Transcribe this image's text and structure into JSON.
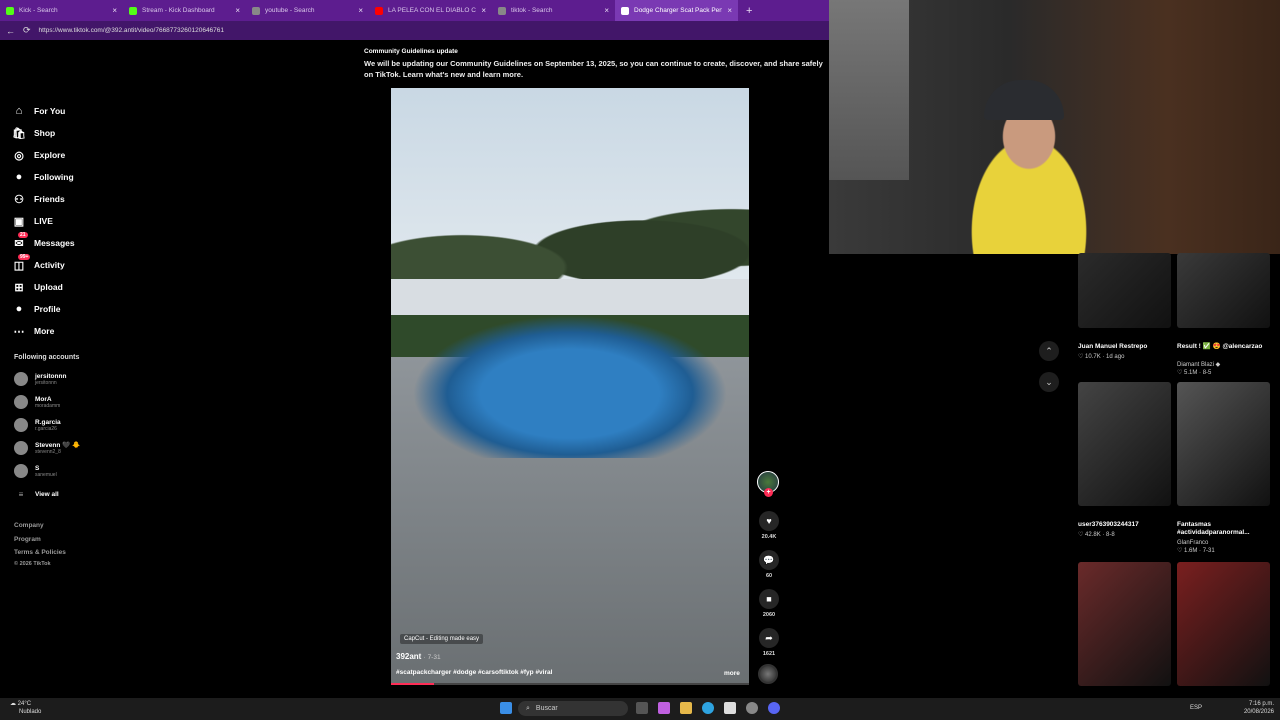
{
  "browser": {
    "tabs": [
      {
        "title": "Kick - Search",
        "color": "#53fc18"
      },
      {
        "title": "Stream - Kick Dashboard",
        "color": "#53fc18"
      },
      {
        "title": "youtube - Search",
        "color": "#888888"
      },
      {
        "title": "LA PELEA CON EL DIABLO CICTA...",
        "color": "#ff0000"
      },
      {
        "title": "tiktok - Search",
        "color": "#888888"
      },
      {
        "title": "Dodge Charger Scat Pack Perform...",
        "color": "#ffffff"
      }
    ],
    "url": "https://www.tiktok.com/@392.antit/video/7668773260120646761"
  },
  "sidebar": {
    "items": [
      {
        "label": "For You",
        "icon": "home-icon",
        "glyph": "⌂"
      },
      {
        "label": "Shop",
        "icon": "shop-icon",
        "glyph": "🛍"
      },
      {
        "label": "Explore",
        "icon": "compass-icon",
        "glyph": "◎"
      },
      {
        "label": "Following",
        "icon": "following-avatar-icon",
        "glyph": "●"
      },
      {
        "label": "Friends",
        "icon": "friends-icon",
        "glyph": "⚇"
      },
      {
        "label": "LIVE",
        "icon": "live-icon",
        "glyph": "▣"
      },
      {
        "label": "Messages",
        "icon": "messages-icon",
        "glyph": "✉",
        "badge": "21"
      },
      {
        "label": "Activity",
        "icon": "activity-icon",
        "glyph": "◫",
        "badge": "99+"
      },
      {
        "label": "Upload",
        "icon": "upload-icon",
        "glyph": "⊞"
      },
      {
        "label": "Profile",
        "icon": "profile-icon",
        "glyph": "●"
      },
      {
        "label": "More",
        "icon": "more-icon",
        "glyph": "⋯"
      }
    ],
    "following_title": "Following accounts",
    "accounts": [
      {
        "name": "jersitonnn",
        "handle": "jersitonnn"
      },
      {
        "name": "MorA",
        "handle": "moradamm"
      },
      {
        "name": "R.garcia",
        "handle": "r.garcia26"
      },
      {
        "name": "Stevenn 🖤 🐥",
        "handle": "stevenn2_8"
      },
      {
        "name": "S",
        "handle": "sanemuel"
      }
    ],
    "view_all": "View all",
    "footer": [
      "Company",
      "Program",
      "Terms & Policies",
      "© 2026 TikTok"
    ]
  },
  "notice": {
    "title": "Community Guidelines update",
    "body": "We will be updating our Community Guidelines on September 13, 2025, so you can continue to create, discover, and share safely on TikTok. Learn what's new and learn more."
  },
  "video": {
    "capcut": "CapCut - Editing made easy",
    "author": "392ant",
    "date": "· 7-31",
    "tags": "#scatpackcharger #dodge #carsoftiktok #fyp #viral",
    "more": "more",
    "progress": 0.12,
    "likes": "20.4K",
    "comments": "60",
    "saves": "2060",
    "shares": "1621"
  },
  "grid": [
    {
      "title": "Juan Manuel Restrepo",
      "stats": "♡ 10.7K · 1d ago",
      "bg": "#2b2b2b"
    },
    {
      "title": "Result ! ✅ 😍 @alencarzao",
      "stats": "Diamant Blazi ◆",
      "stats2": "♡ 5.1M · 8-5",
      "bg": "#3a3a3a"
    },
    {
      "title": "user3763903244317",
      "stats": "♡ 42.8K · 8-8",
      "bg": "#444444"
    },
    {
      "title": "Fantasmas #actividadparanormal...",
      "stats": "GlanFranco",
      "stats2": "♡ 1.6M · 7-31",
      "bg": "#555555"
    },
    {
      "title": "",
      "stats": "",
      "bg": "#6a2a2a"
    },
    {
      "title": "",
      "stats": "",
      "bg": "#7a1f1f"
    }
  ],
  "taskbar": {
    "temp": "24°C",
    "weather": "Nublado",
    "search": "Buscar",
    "lang": "ESP",
    "time": "7:16 p.m.",
    "date": "20/08/2026"
  }
}
